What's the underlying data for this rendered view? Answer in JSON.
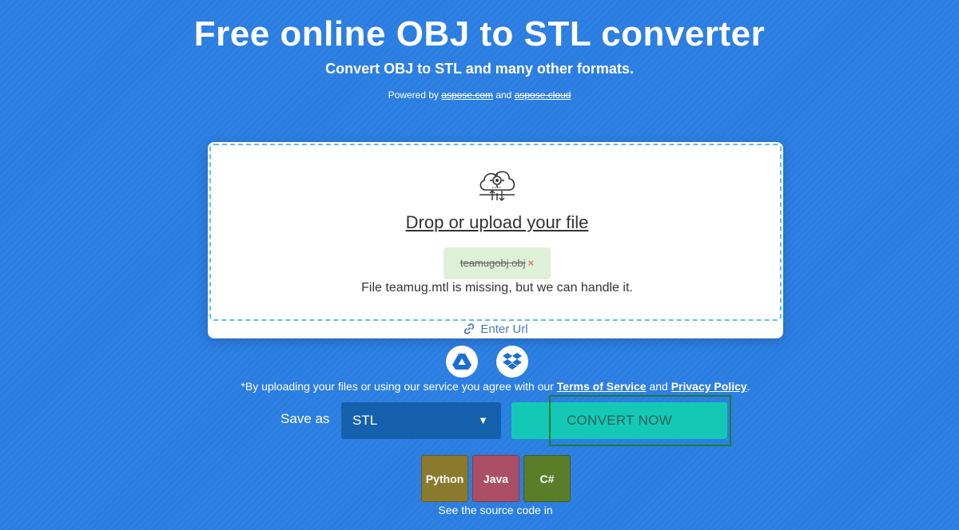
{
  "header": {
    "title": "Free online OBJ to STL converter",
    "subtitle": "Convert OBJ to STL and many other formats.",
    "powered_prefix": "Powered by",
    "powered_link1": "aspose.com",
    "powered_and": "and",
    "powered_link2": "aspose.cloud"
  },
  "upload": {
    "drop_label": "Drop or upload your file",
    "file_name": "teamugobj.obj",
    "remove_glyph": "×",
    "missing_message": "File teamug.mtl is missing, but we can handle it.",
    "enter_url": "Enter Url"
  },
  "cloud": {
    "icons": [
      "google-drive-icon",
      "dropbox-icon"
    ]
  },
  "agreement": {
    "prefix": "*By uploading your files or using our service you agree with our",
    "terms": "Terms of Service",
    "and": "and",
    "privacy": "Privacy Policy",
    "suffix": "."
  },
  "convert": {
    "save_as_label": "Save as",
    "selected_format": "STL",
    "dropdown_arrow": "▼",
    "button_label": "CONVERT NOW"
  },
  "source": {
    "langs": [
      "Python",
      "Java",
      "C#"
    ],
    "note": "See the source code in"
  },
  "colors": {
    "background": "#2a7de1",
    "select": "#1560ad",
    "convert": "#13c9b5",
    "python": "#8a7a2e",
    "java": "#ab4f66",
    "csharp": "#5a7d2a"
  }
}
